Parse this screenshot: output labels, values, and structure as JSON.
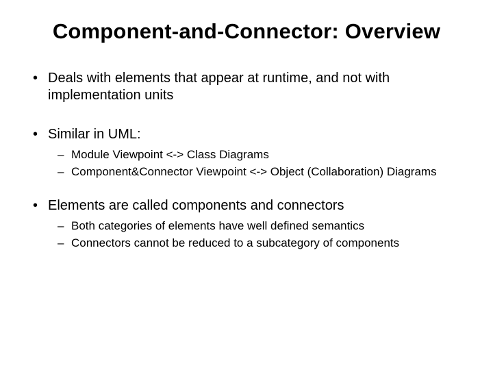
{
  "title": "Component-and-Connector: Overview",
  "bullets": {
    "b1": "Deals with elements that appear at runtime, and not with implementation units",
    "b2": "Similar in UML:",
    "b2_sub": {
      "s1": "Module Viewpoint <-> Class Diagrams",
      "s2": "Component&Connector Viewpoint <-> Object (Collaboration) Diagrams"
    },
    "b3": "Elements  are called components and connectors",
    "b3_sub": {
      "s1": "Both categories of elements have well defined semantics",
      "s2": "Connectors cannot be reduced to a subcategory of components"
    }
  }
}
